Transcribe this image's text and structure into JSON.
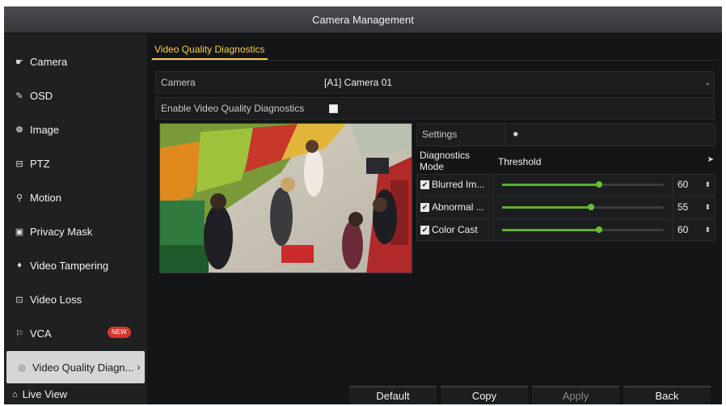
{
  "window": {
    "title": "Camera Management"
  },
  "sidebar": {
    "items": [
      {
        "label": "Camera",
        "icon": "camera-icon"
      },
      {
        "label": "OSD",
        "icon": "osd-icon"
      },
      {
        "label": "Image",
        "icon": "image-icon"
      },
      {
        "label": "PTZ",
        "icon": "ptz-icon"
      },
      {
        "label": "Motion",
        "icon": "motion-icon"
      },
      {
        "label": "Privacy Mask",
        "icon": "privacy-mask-icon"
      },
      {
        "label": "Video Tampering",
        "icon": "video-tampering-icon"
      },
      {
        "label": "Video Loss",
        "icon": "video-loss-icon"
      },
      {
        "label": "VCA",
        "icon": "vca-icon",
        "badge": "NEW"
      },
      {
        "label": "Video Quality Diagn...",
        "icon": "diagnostics-icon",
        "active": true,
        "chevron": "›"
      }
    ],
    "live_view": "Live View"
  },
  "tab": {
    "label": "Video Quality Diagnostics"
  },
  "form": {
    "camera_label": "Camera",
    "camera_value": "[A1] Camera 01",
    "enable_label": "Enable Video Quality Diagnostics",
    "enable_checked": false
  },
  "settings": {
    "label": "Settings",
    "icon": "gear-icon"
  },
  "diagnostics": {
    "mode_header": "Diagnostics Mode",
    "threshold_header": "Threshold",
    "rows": [
      {
        "name": "Blurred Im...",
        "checked": true,
        "value": "60",
        "level": 0.6
      },
      {
        "name": "Abnormal ...",
        "checked": true,
        "value": "55",
        "level": 0.55
      },
      {
        "name": "Color Cast",
        "checked": true,
        "value": "60",
        "level": 0.6
      }
    ]
  },
  "buttons": {
    "default": "Default",
    "copy": "Copy",
    "apply": "Apply",
    "back": "Back"
  },
  "colors": {
    "accent": "#f5d24a",
    "slider": "#5fae2d",
    "badge": "#d9342b"
  }
}
